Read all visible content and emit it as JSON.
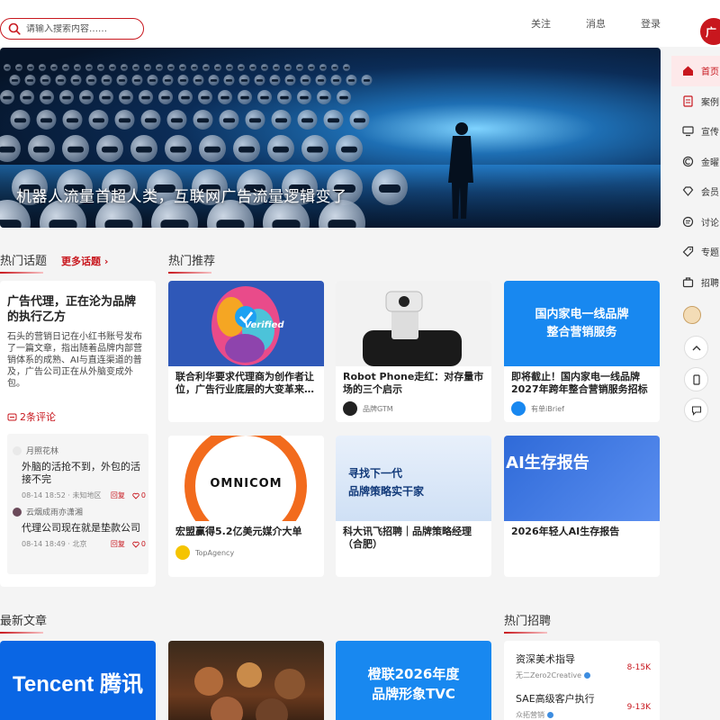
{
  "header": {
    "search_placeholder": "请输入搜索内容……",
    "nav": [
      "关注",
      "消息",
      "登录"
    ],
    "logo_text": "广"
  },
  "sidebar": {
    "items": [
      {
        "label": "首页",
        "icon": "home-icon",
        "active": true
      },
      {
        "label": "案例",
        "icon": "case-icon",
        "active": false
      },
      {
        "label": "宣传",
        "icon": "monitor-icon",
        "active": false
      },
      {
        "label": "金曜",
        "icon": "coin-icon",
        "active": false
      },
      {
        "label": "会员",
        "icon": "diamond-icon",
        "active": false
      },
      {
        "label": "讨论",
        "icon": "chat-icon",
        "active": false
      },
      {
        "label": "专题",
        "icon": "tag-icon",
        "active": false
      },
      {
        "label": "招聘",
        "icon": "briefcase-icon",
        "active": false
      }
    ]
  },
  "hero": {
    "caption": "机器人流量首超人类，互联网广告流量逻辑变了"
  },
  "hot_topics": {
    "title": "热门话题",
    "more": "更多话题",
    "card": {
      "title": "广告代理，正在沦为品牌的执行乙方",
      "body": "石头的营销日记在小红书账号发布了一篇文章，指出随着品牌内部营销体系的成熟、AI与直连渠道的普及，广告公司正在从外脑变成外包。",
      "comments": "2条评论"
    },
    "comments": [
      {
        "user": "月照花林",
        "text": "外脑的活抢不到，外包的活接不完",
        "time": "08-14 18:52 · 未知地区",
        "reply": "回复",
        "likes": "0"
      },
      {
        "user": "云烟成雨亦潇湘",
        "text": "代理公司现在就是垫款公司",
        "time": "08-14 18:49 · 北京",
        "reply": "回复",
        "likes": "0"
      }
    ]
  },
  "recommend": {
    "title": "热门推荐",
    "cards": [
      {
        "title": "联合利华要求代理商为创作者让位，广告行业底层的大变革来…",
        "source": "",
        "image_text": "Verified"
      },
      {
        "title": "Robot Phone走红：对存量市场的三个启示",
        "source": "品牌GTM",
        "image_text": ""
      },
      {
        "title": "即将截止！国内家电一线品牌2027年跨年整合营销服务招标",
        "source": "有单iBrief",
        "image_text": "国内家电一线品牌\n整合营销服务"
      },
      {
        "title": "宏盟赢得5.2亿美元媒介大单",
        "source": "TopAgency",
        "image_text": "OMNICOM"
      },
      {
        "title": "科大讯飞招聘｜品牌策略经理（合肥）",
        "source": "",
        "image_text": "寻找下一代\n品牌策略实干家"
      },
      {
        "title": "2026年轻人AI生存报告",
        "source": "",
        "image_text": "AI生存报告"
      }
    ]
  },
  "latest": {
    "title": "最新文章",
    "articles": [
      {
        "image_text": "Tencent 腾讯"
      },
      {
        "image_text": ""
      },
      {
        "image_text": "橙联2026年度\n品牌形象TVC"
      }
    ]
  },
  "jobs": {
    "title": "热门招聘",
    "items": [
      {
        "title": "资深美术指导",
        "company": "无二Zero2Creative",
        "salary": "8-15K"
      },
      {
        "title": "SAE高级客户执行",
        "company": "众拓营销",
        "salary": "9-13K"
      }
    ]
  },
  "colors": {
    "accent": "#c8171e",
    "blue": "#1888f0"
  }
}
